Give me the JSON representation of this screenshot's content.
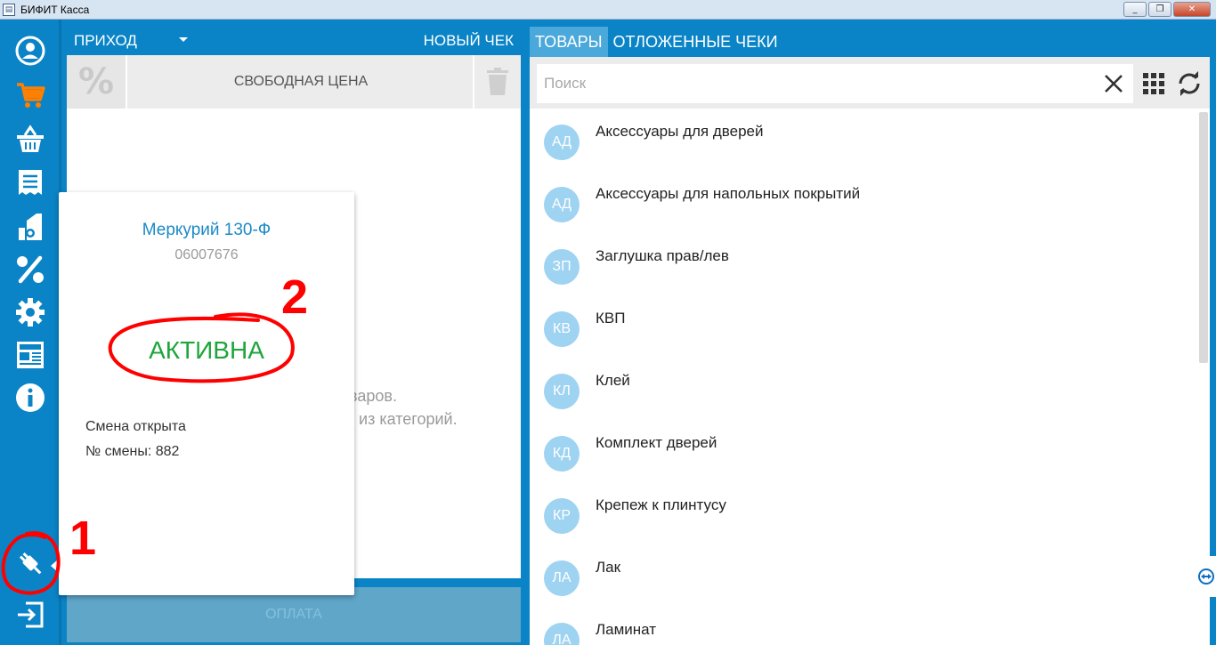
{
  "window": {
    "title": "БИФИТ Касса",
    "minimize": "_",
    "maximize": "❐",
    "close": "✕"
  },
  "sidebar": {
    "icons": [
      "account-icon",
      "cart-icon",
      "basket-icon",
      "receipt-icon",
      "reports-icon",
      "discount-icon",
      "settings-icon",
      "news-icon",
      "info-icon",
      "device-connection-icon",
      "logout-icon"
    ]
  },
  "left_panel": {
    "operation": "ПРИХОД",
    "new_check": "НОВЫЙ ЧЕК",
    "discount_symbol": "%",
    "free_price": "СВОБОДНАЯ ЦЕНА",
    "empty_line1": "варов.",
    "empty_line2": "ар из категорий.",
    "pay": "ОПЛАТА"
  },
  "popup": {
    "device": "Меркурий 130-Ф",
    "serial": "06007676",
    "status": "АКТИВНА",
    "shift_status": "Смена открыта",
    "shift_number": "№ смены: 882"
  },
  "annotations": {
    "one": "1",
    "two": "2"
  },
  "right_panel": {
    "tabs": [
      "ТОВАРЫ",
      "ОТЛОЖЕННЫЕ ЧЕКИ"
    ],
    "search_placeholder": "Поиск",
    "items": [
      {
        "initials": "АД",
        "label": "Аксессуары для дверей"
      },
      {
        "initials": "АД",
        "label": "Аксессуары для напольных покрытий"
      },
      {
        "initials": "ЗП",
        "label": "Заглушка прав/лев"
      },
      {
        "initials": "КВ",
        "label": "КВП"
      },
      {
        "initials": "КЛ",
        "label": "Клей"
      },
      {
        "initials": "КД",
        "label": "Комплект дверей"
      },
      {
        "initials": "КР",
        "label": "Крепеж к плинтусу"
      },
      {
        "initials": "ЛА",
        "label": "Лак"
      },
      {
        "initials": "ЛА",
        "label": "Ламинат"
      }
    ]
  },
  "colors": {
    "primary": "#0a84c6",
    "active_status": "#1ea53b",
    "annotation": "#ff0000",
    "avatar": "#9fd3f2"
  }
}
